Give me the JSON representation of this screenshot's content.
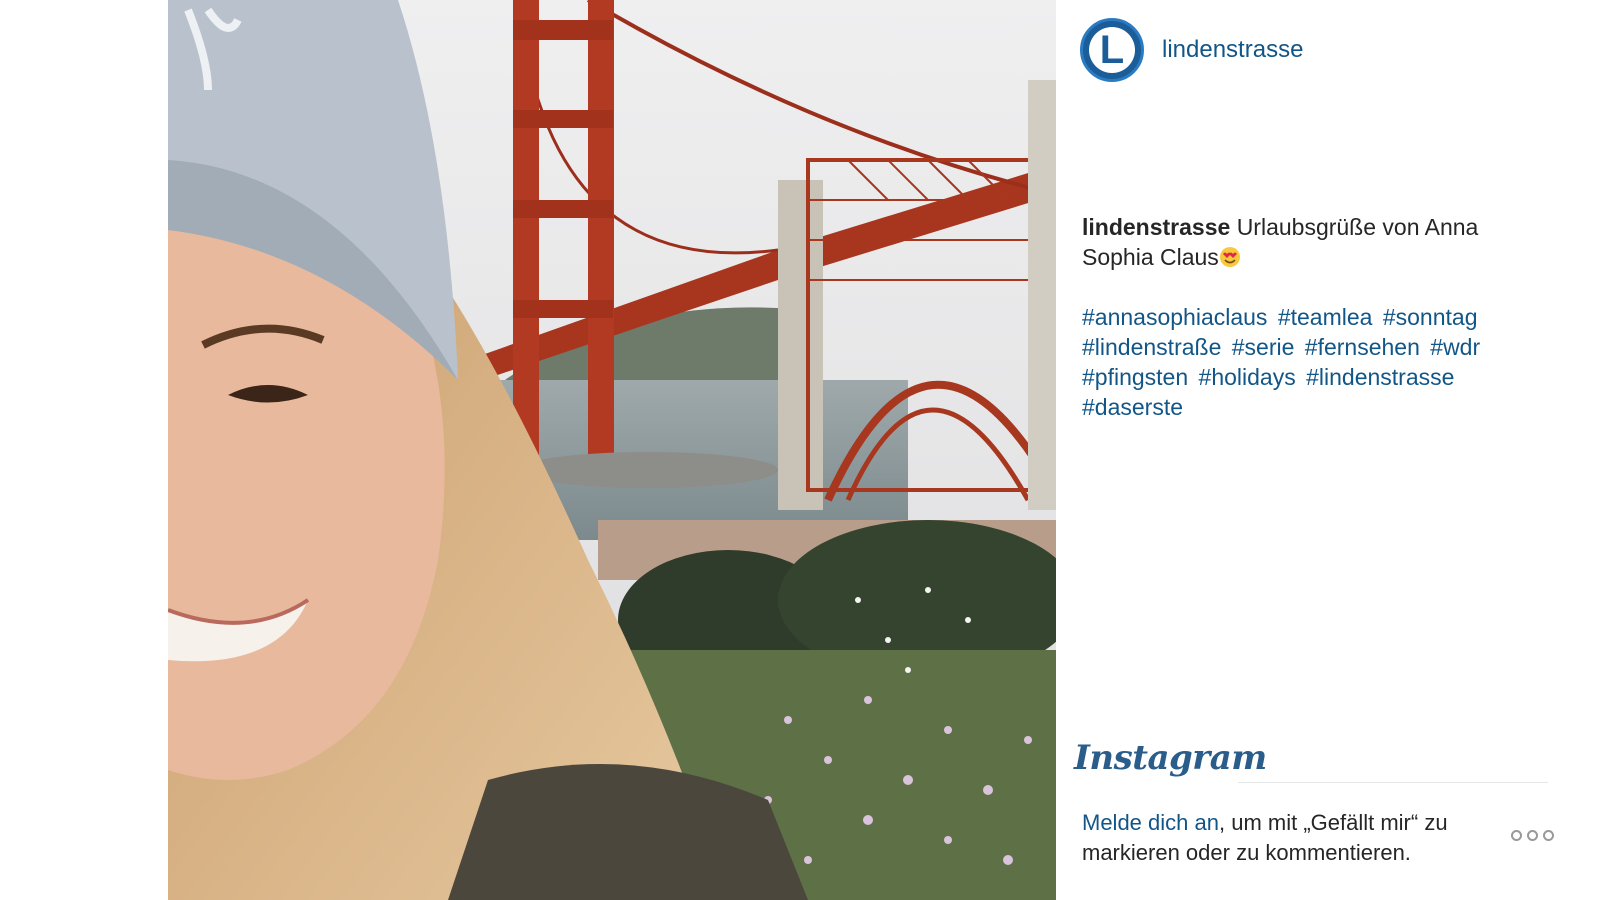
{
  "post": {
    "username": "lindenstrasse",
    "avatar_letter": "L",
    "caption_user": "lindenstrasse",
    "caption_text": "Urlaubsgrüße von Anna Sophia Claus",
    "hashtags": [
      "#annasophiaclaus",
      "#teamlea",
      "#sonntag",
      "#lindenstraße",
      "#serie",
      "#fernsehen",
      "#wdr",
      "#pfingsten",
      "#holidays",
      "#lindenstrasse",
      "#daserste"
    ]
  },
  "footer": {
    "logo_text": "Instagram",
    "login_link": "Melde dich an",
    "login_text": ", um mit „Gefällt mir“ zu markieren oder zu kommentieren."
  },
  "icons": {
    "emoji": "heart-eyes-emoji-icon",
    "more": "more-options-icon"
  },
  "colors": {
    "link": "#125688",
    "avatar_blue": "#1b5d99",
    "bridge": "#b23a22"
  }
}
